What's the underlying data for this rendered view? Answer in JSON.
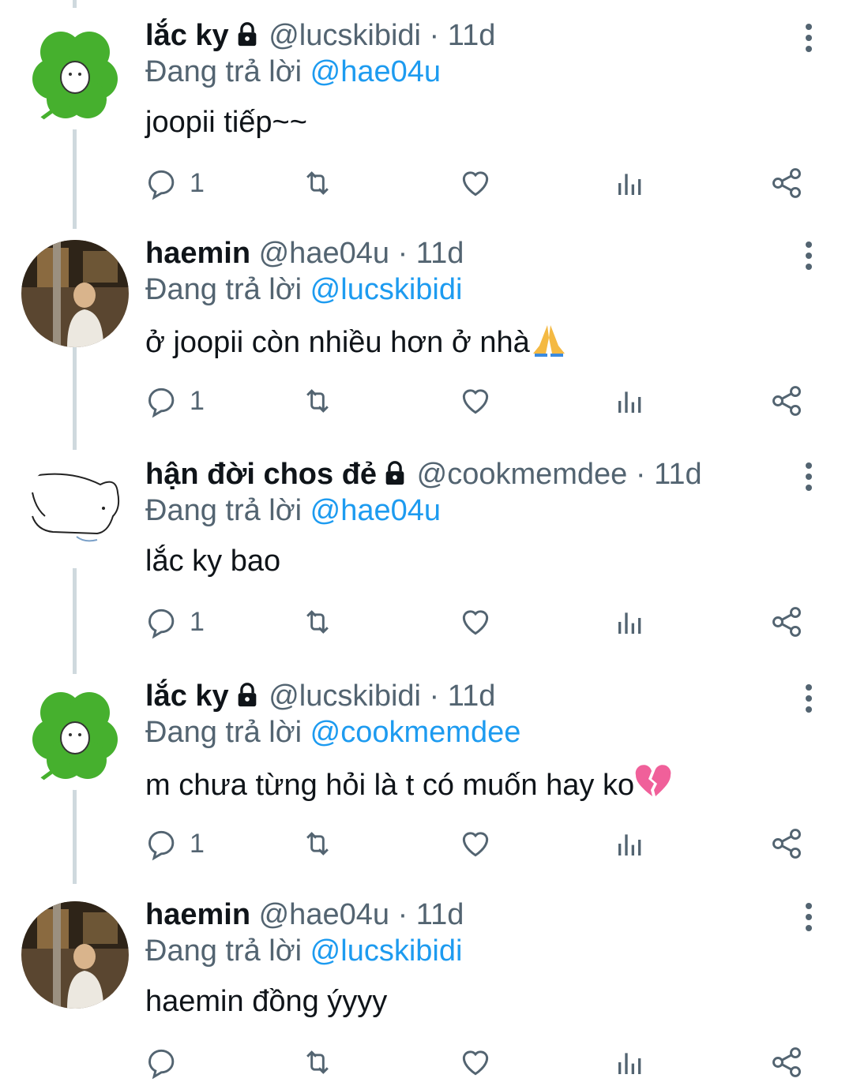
{
  "tweets": [
    {
      "name": "lắc ky",
      "locked": true,
      "handle": "@lucskibidi",
      "dot": "·",
      "time": "11d",
      "replying_prefix": "Đang trả lời ",
      "replying_to": "@hae04u",
      "text": "joopii tiếp~~",
      "reply_count": "1",
      "avatar": "clover"
    },
    {
      "name": "haemin",
      "locked": false,
      "handle": "@hae04u",
      "dot": "·",
      "time": "11d",
      "replying_prefix": "Đang trả lời ",
      "replying_to": "@lucskibidi",
      "text": "ở joopii còn nhiều hơn ở nhà",
      "emoji": "folded-hands",
      "reply_count": "1",
      "avatar": "photo"
    },
    {
      "name": "hận đời chos đẻ",
      "locked": true,
      "handle": "@cookmemdee",
      "dot": "·",
      "time": "11d",
      "replying_prefix": "Đang trả lời ",
      "replying_to": "@hae04u",
      "text": "lắc ky bao",
      "reply_count": "1",
      "avatar": "sketch"
    },
    {
      "name": "lắc ky",
      "locked": true,
      "handle": "@lucskibidi",
      "dot": "·",
      "time": "11d",
      "replying_prefix": "Đang trả lời ",
      "replying_to": "@cookmemdee",
      "text": "m chưa từng hỏi là t có muốn hay ko",
      "emoji": "broken-heart",
      "reply_count": "1",
      "avatar": "clover"
    },
    {
      "name": "haemin",
      "locked": false,
      "handle": "@hae04u",
      "dot": "·",
      "time": "11d",
      "replying_prefix": "Đang trả lời ",
      "replying_to": "@lucskibidi",
      "text": "haemin đồng ýyyy",
      "reply_count": "",
      "avatar": "photo"
    }
  ],
  "colors": {
    "text": "#0f1419",
    "secondary": "#536471",
    "link": "#1d9bf0",
    "thread_line": "#cfd9de"
  }
}
